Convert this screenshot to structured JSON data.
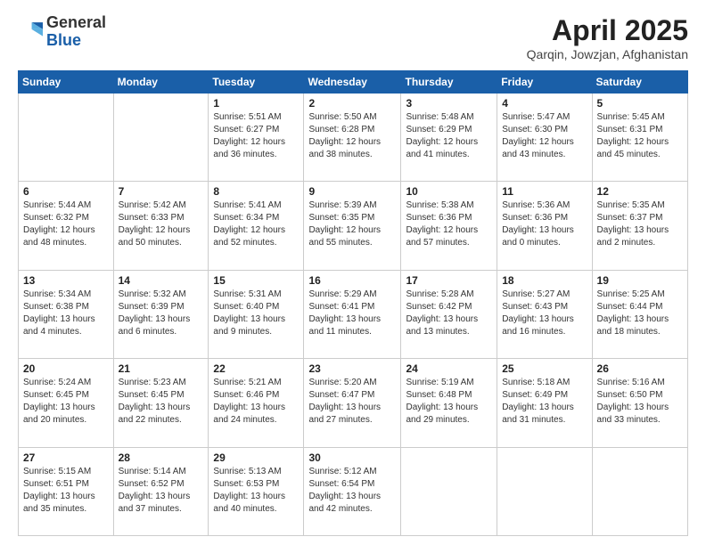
{
  "header": {
    "logo_general": "General",
    "logo_blue": "Blue",
    "title": "April 2025",
    "subtitle": "Qarqin, Jowzjan, Afghanistan"
  },
  "calendar": {
    "days_of_week": [
      "Sunday",
      "Monday",
      "Tuesday",
      "Wednesday",
      "Thursday",
      "Friday",
      "Saturday"
    ],
    "weeks": [
      [
        {
          "day": "",
          "info": ""
        },
        {
          "day": "",
          "info": ""
        },
        {
          "day": "1",
          "info": "Sunrise: 5:51 AM\nSunset: 6:27 PM\nDaylight: 12 hours and 36 minutes."
        },
        {
          "day": "2",
          "info": "Sunrise: 5:50 AM\nSunset: 6:28 PM\nDaylight: 12 hours and 38 minutes."
        },
        {
          "day": "3",
          "info": "Sunrise: 5:48 AM\nSunset: 6:29 PM\nDaylight: 12 hours and 41 minutes."
        },
        {
          "day": "4",
          "info": "Sunrise: 5:47 AM\nSunset: 6:30 PM\nDaylight: 12 hours and 43 minutes."
        },
        {
          "day": "5",
          "info": "Sunrise: 5:45 AM\nSunset: 6:31 PM\nDaylight: 12 hours and 45 minutes."
        }
      ],
      [
        {
          "day": "6",
          "info": "Sunrise: 5:44 AM\nSunset: 6:32 PM\nDaylight: 12 hours and 48 minutes."
        },
        {
          "day": "7",
          "info": "Sunrise: 5:42 AM\nSunset: 6:33 PM\nDaylight: 12 hours and 50 minutes."
        },
        {
          "day": "8",
          "info": "Sunrise: 5:41 AM\nSunset: 6:34 PM\nDaylight: 12 hours and 52 minutes."
        },
        {
          "day": "9",
          "info": "Sunrise: 5:39 AM\nSunset: 6:35 PM\nDaylight: 12 hours and 55 minutes."
        },
        {
          "day": "10",
          "info": "Sunrise: 5:38 AM\nSunset: 6:36 PM\nDaylight: 12 hours and 57 minutes."
        },
        {
          "day": "11",
          "info": "Sunrise: 5:36 AM\nSunset: 6:36 PM\nDaylight: 13 hours and 0 minutes."
        },
        {
          "day": "12",
          "info": "Sunrise: 5:35 AM\nSunset: 6:37 PM\nDaylight: 13 hours and 2 minutes."
        }
      ],
      [
        {
          "day": "13",
          "info": "Sunrise: 5:34 AM\nSunset: 6:38 PM\nDaylight: 13 hours and 4 minutes."
        },
        {
          "day": "14",
          "info": "Sunrise: 5:32 AM\nSunset: 6:39 PM\nDaylight: 13 hours and 6 minutes."
        },
        {
          "day": "15",
          "info": "Sunrise: 5:31 AM\nSunset: 6:40 PM\nDaylight: 13 hours and 9 minutes."
        },
        {
          "day": "16",
          "info": "Sunrise: 5:29 AM\nSunset: 6:41 PM\nDaylight: 13 hours and 11 minutes."
        },
        {
          "day": "17",
          "info": "Sunrise: 5:28 AM\nSunset: 6:42 PM\nDaylight: 13 hours and 13 minutes."
        },
        {
          "day": "18",
          "info": "Sunrise: 5:27 AM\nSunset: 6:43 PM\nDaylight: 13 hours and 16 minutes."
        },
        {
          "day": "19",
          "info": "Sunrise: 5:25 AM\nSunset: 6:44 PM\nDaylight: 13 hours and 18 minutes."
        }
      ],
      [
        {
          "day": "20",
          "info": "Sunrise: 5:24 AM\nSunset: 6:45 PM\nDaylight: 13 hours and 20 minutes."
        },
        {
          "day": "21",
          "info": "Sunrise: 5:23 AM\nSunset: 6:45 PM\nDaylight: 13 hours and 22 minutes."
        },
        {
          "day": "22",
          "info": "Sunrise: 5:21 AM\nSunset: 6:46 PM\nDaylight: 13 hours and 24 minutes."
        },
        {
          "day": "23",
          "info": "Sunrise: 5:20 AM\nSunset: 6:47 PM\nDaylight: 13 hours and 27 minutes."
        },
        {
          "day": "24",
          "info": "Sunrise: 5:19 AM\nSunset: 6:48 PM\nDaylight: 13 hours and 29 minutes."
        },
        {
          "day": "25",
          "info": "Sunrise: 5:18 AM\nSunset: 6:49 PM\nDaylight: 13 hours and 31 minutes."
        },
        {
          "day": "26",
          "info": "Sunrise: 5:16 AM\nSunset: 6:50 PM\nDaylight: 13 hours and 33 minutes."
        }
      ],
      [
        {
          "day": "27",
          "info": "Sunrise: 5:15 AM\nSunset: 6:51 PM\nDaylight: 13 hours and 35 minutes."
        },
        {
          "day": "28",
          "info": "Sunrise: 5:14 AM\nSunset: 6:52 PM\nDaylight: 13 hours and 37 minutes."
        },
        {
          "day": "29",
          "info": "Sunrise: 5:13 AM\nSunset: 6:53 PM\nDaylight: 13 hours and 40 minutes."
        },
        {
          "day": "30",
          "info": "Sunrise: 5:12 AM\nSunset: 6:54 PM\nDaylight: 13 hours and 42 minutes."
        },
        {
          "day": "",
          "info": ""
        },
        {
          "day": "",
          "info": ""
        },
        {
          "day": "",
          "info": ""
        }
      ]
    ]
  }
}
